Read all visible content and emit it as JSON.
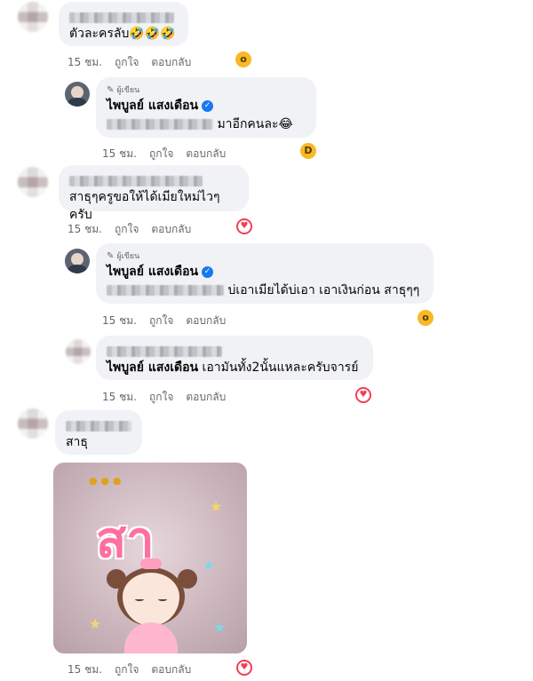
{
  "comments": [
    {
      "id": "c1",
      "text": "ตัวละครลับ🤣🤣🤣",
      "time": "15 ชม.",
      "like": "ถูกใจ",
      "reply": "ตอบกลับ",
      "reaction": "wow-icon"
    },
    {
      "id": "r1",
      "badge": "ผู้เขียน",
      "name": "ไพบูลย์ แสงเดือน",
      "text": "มาอีกคนละ😂",
      "time": "15 ชม.",
      "like": "ถูกใจ",
      "reply": "ตอบกลับ",
      "reaction": "haha-icon"
    },
    {
      "id": "c2",
      "text": "สาธุๆครูขอให้ได้เมียใหม่ไวๆครับ",
      "time": "15 ชม.",
      "like": "ถูกใจ",
      "reply": "ตอบกลับ",
      "reaction": "love-icon"
    },
    {
      "id": "r2",
      "badge": "ผู้เขียน",
      "name": "ไพบูลย์ แสงเดือน",
      "text": "บ่เอาเมียได้บ่เอา เอาเงินก่อน สาธุๆๆ",
      "time": "15 ชม.",
      "like": "ถูกใจ",
      "reply": "ตอบกลับ",
      "reaction": "wow-icon"
    },
    {
      "id": "r3",
      "mention": "ไพบูลย์ แสงเดือน",
      "text": "เอามันทั้ง2นั้นแหละครับจารย์",
      "time": "15 ชม.",
      "like": "ถูกใจ",
      "reply": "ตอบกลับ",
      "reaction": "love-icon"
    },
    {
      "id": "c3",
      "text": "สาธุ",
      "sticker_word": "สา",
      "time": "15 ชม.",
      "like": "ถูกใจ",
      "reply": "ตอบกลับ",
      "reaction": "love-icon"
    }
  ],
  "colors": {
    "bubble": "#f0f2f5",
    "meta": "#65676b",
    "verified": "#1877f2",
    "love": "#f33e58",
    "wow": "#f7b928"
  }
}
